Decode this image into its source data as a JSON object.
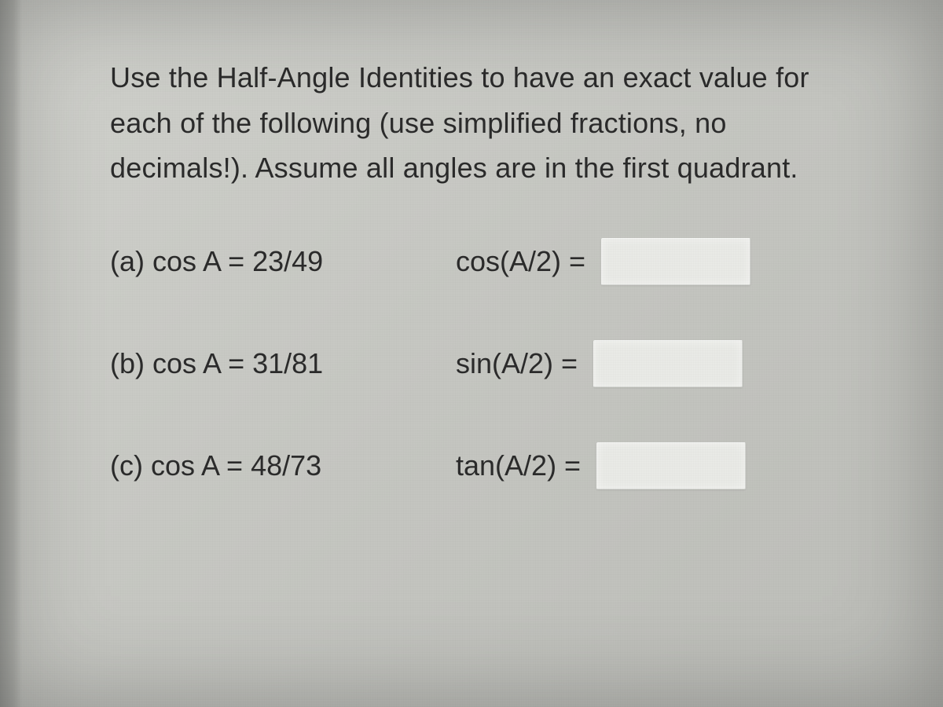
{
  "instructions": "Use the Half-Angle Identities to have an exact value for each of the following (use simplified fractions, no decimals!).  Assume all angles are in the first quadrant.",
  "problems": {
    "a": {
      "given": "(a) cos A = 23/49",
      "target_label": "cos(A/2) =",
      "answer": ""
    },
    "b": {
      "given": "(b) cos A = 31/81",
      "target_label": "sin(A/2) =",
      "answer": ""
    },
    "c": {
      "given": "(c) cos A = 48/73",
      "target_label": "tan(A/2) =",
      "answer": ""
    }
  }
}
